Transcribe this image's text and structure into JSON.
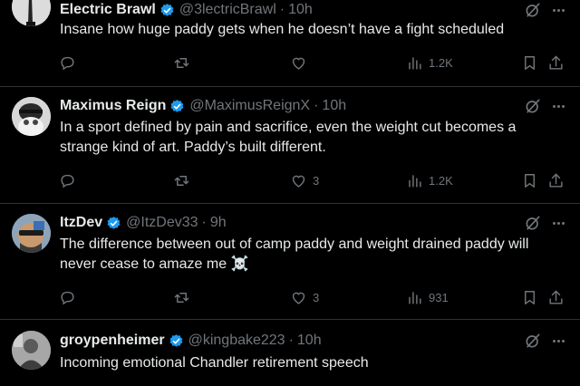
{
  "tweets": [
    {
      "name": "Electric Brawl",
      "handle": "@3lectricBrawl",
      "separator": "·",
      "time": "10h",
      "text": "Insane how huge paddy gets when he doesn’t have a fight scheduled",
      "replies": "",
      "retweets": "",
      "likes": "",
      "views": "1.2K"
    },
    {
      "name": "Maximus Reign",
      "handle": "@MaximusReignX",
      "separator": "·",
      "time": "10h",
      "text": "In a sport defined by pain and sacrifice, even the weight cut becomes a strange kind of art. Paddy’s built different.",
      "replies": "",
      "retweets": "",
      "likes": "3",
      "views": "1.2K"
    },
    {
      "name": "ItzDev",
      "handle": "@ItzDev33",
      "separator": "·",
      "time": "9h",
      "text": "The difference between out of camp paddy and weight drained paddy will never cease to amaze me ☠️",
      "replies": "",
      "retweets": "",
      "likes": "3",
      "views": "931"
    },
    {
      "name": "groypenheimer",
      "handle": "@kingbake223",
      "separator": "·",
      "time": "10h",
      "text": "Incoming emotional Chandler retirement speech"
    }
  ],
  "colors": {
    "background": "#000000",
    "text": "#e7e9ea",
    "muted": "#71767b",
    "verified": "#1d9bf0",
    "divider": "#2f3336"
  },
  "icons": [
    "reply-icon",
    "retweet-icon",
    "like-icon",
    "views-icon",
    "bookmark-icon",
    "share-icon",
    "grok-icon",
    "more-icon",
    "verified-badge-icon"
  ]
}
